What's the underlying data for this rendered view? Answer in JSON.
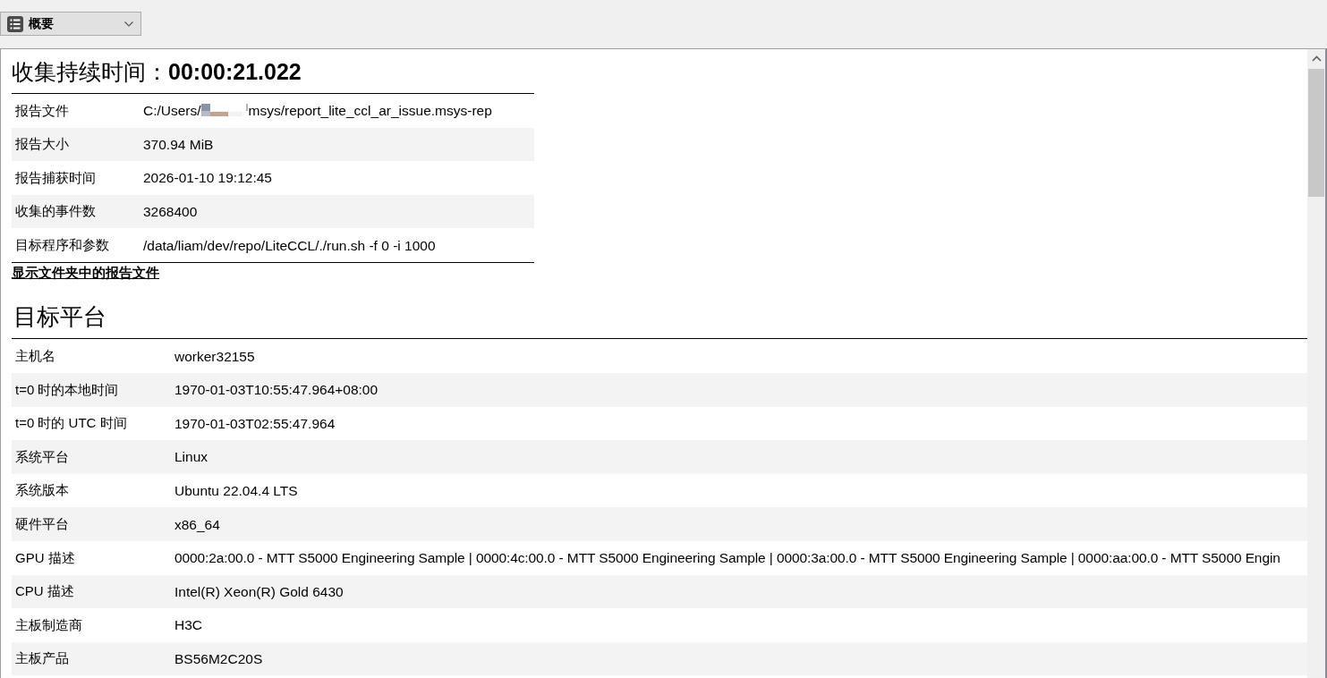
{
  "toolbar": {
    "view_select": {
      "value": "概要"
    }
  },
  "summary": {
    "title": "收集持续时间：**00:00:21.022**",
    "rows": [
      {
        "label": "报告文件",
        "value": "C:/Users/",
        "value_after_redaction": "msys/report_lite_ccl_ar_issue.msys-rep"
      },
      {
        "label": "报告大小",
        "value": "370.94 MiB"
      },
      {
        "label": "报告捕获时间",
        "value": "2026-01-10 19:12:45"
      },
      {
        "label": "收集的事件数",
        "value": "3268400"
      },
      {
        "label": "目标程序和参数",
        "value": "/data/liam/dev/repo/LiteCCL/./run.sh -f 0 -i 1000"
      }
    ],
    "link": "显示文件夹中的报告文件"
  },
  "platform": {
    "title": "目标平台",
    "rows": [
      {
        "label": "主机名",
        "value": "worker32155"
      },
      {
        "label": "t=0 时的本地时间",
        "value": "1970-01-03T10:55:47.964+08:00"
      },
      {
        "label": "t=0 时的 UTC 时间",
        "value": "1970-01-03T02:55:47.964"
      },
      {
        "label": "系统平台",
        "value": "Linux"
      },
      {
        "label": "系统版本",
        "value": "Ubuntu 22.04.4 LTS"
      },
      {
        "label": "硬件平台",
        "value": "x86_64"
      },
      {
        "label": "GPU 描述",
        "value": "0000:2a:00.0 - MTT S5000 Engineering Sample | 0000:4c:00.0 - MTT S5000 Engineering Sample | 0000:3a:00.0 - MTT S5000 Engineering Sample | 0000:aa:00.0 - MTT S5000 Engin"
      },
      {
        "label": "CPU 描述",
        "value": "Intel(R) Xeon(R) Gold 6430"
      },
      {
        "label": "主板制造商",
        "value": "H3C"
      },
      {
        "label": "主板产品",
        "value": "BS56M2C20S"
      }
    ]
  }
}
